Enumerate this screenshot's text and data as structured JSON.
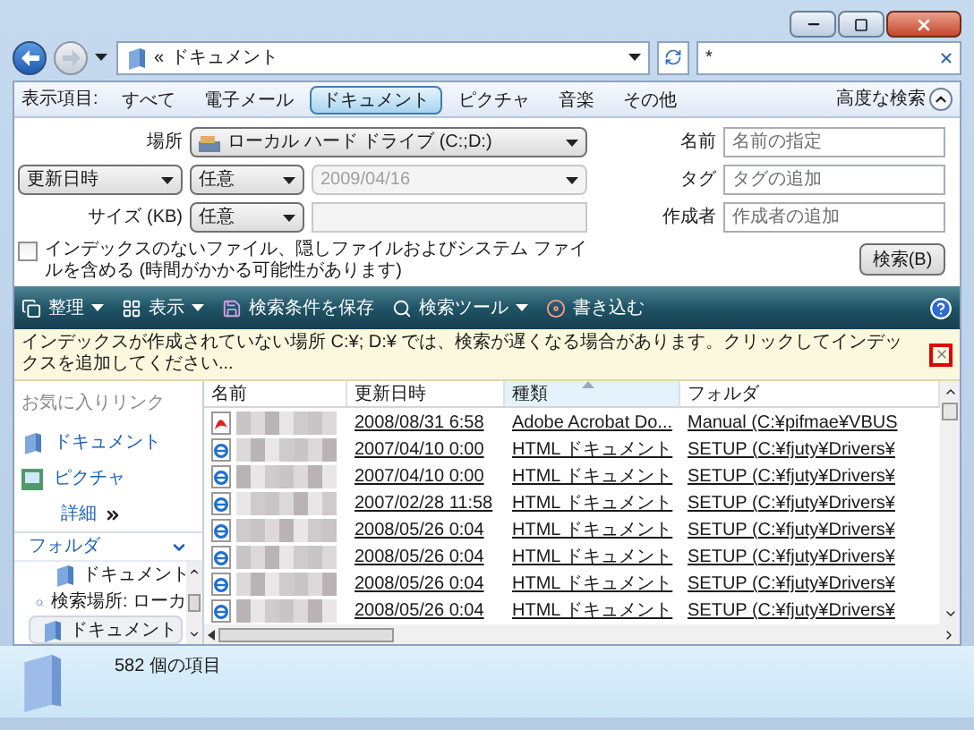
{
  "address": {
    "chevron": "«",
    "path": "ドキュメント"
  },
  "search": {
    "value": "*"
  },
  "filter_bar": {
    "label": "表示項目:",
    "items": [
      {
        "label": "すべて",
        "selected": false
      },
      {
        "label": "電子メール",
        "selected": false
      },
      {
        "label": "ドキュメント",
        "selected": true
      },
      {
        "label": "ピクチャ",
        "selected": false
      },
      {
        "label": "音楽",
        "selected": false
      },
      {
        "label": "その他",
        "selected": false
      }
    ],
    "advanced": "高度な検索",
    "expanded": true
  },
  "advanced_search": {
    "location_label": "場所",
    "location": "ローカル ハード ドライブ (C:;D:)",
    "date_field": "更新日時",
    "date_op": "任意",
    "date_value": "2009/04/16",
    "size_label": "サイズ (KB)",
    "size_op": "任意",
    "include_checkbox": {
      "label": "インデックスのないファイル、隠しファイルおよびシステム ファイルを含める (時間がかかる可能性があります)",
      "checked": false
    },
    "name_label": "名前",
    "name_placeholder": "名前の指定",
    "tag_label": "タグ",
    "tag_placeholder": "タグの追加",
    "author_label": "作成者",
    "author_placeholder": "作成者の追加",
    "search_button": "検索(B)"
  },
  "toolbar": [
    {
      "label": "整理",
      "kind": "menu"
    },
    {
      "label": "表示",
      "kind": "menu"
    },
    {
      "label": "検索条件を保存",
      "kind": "button"
    },
    {
      "label": "検索ツール",
      "kind": "menu"
    },
    {
      "label": "書き込む",
      "kind": "button"
    }
  ],
  "info_bar": {
    "text": "インデックスが作成されていない場所 C:¥; D:¥ では、検索が遅くなる場合があります。クリックしてインデックスを追加してください..."
  },
  "nav": {
    "favorites_title": "お気に入りリンク",
    "links": [
      "ドキュメント",
      "ピクチャ"
    ],
    "more": "詳細",
    "folders_title": "フォルダ",
    "tree": [
      {
        "label": "ドキュメント",
        "selected": false
      },
      {
        "label": "検索場所: ローカ",
        "selected": false,
        "children": [
          {
            "label": "ドキュメント",
            "selected": true
          }
        ]
      }
    ]
  },
  "table": {
    "columns": [
      {
        "label": "名前",
        "sorted": false
      },
      {
        "label": "更新日時",
        "sorted": false
      },
      {
        "label": "種類",
        "sorted": true
      },
      {
        "label": "フォルダ",
        "sorted": false
      }
    ],
    "rows": [
      {
        "kind": "pdf",
        "date": "2008/08/31 6:58",
        "type": "Adobe Acrobat Do...",
        "folder": "Manual (C:¥pifmae¥VBUS"
      },
      {
        "kind": "html",
        "date": "2007/04/10 0:00",
        "type": "HTML ドキュメント",
        "folder": "SETUP (C:¥fjuty¥Drivers¥"
      },
      {
        "kind": "html",
        "date": "2007/04/10 0:00",
        "type": "HTML ドキュメント",
        "folder": "SETUP (C:¥fjuty¥Drivers¥"
      },
      {
        "kind": "html",
        "date": "2007/02/28 11:58",
        "type": "HTML ドキュメント",
        "folder": "SETUP (C:¥fjuty¥Drivers¥"
      },
      {
        "kind": "html",
        "date": "2008/05/26 0:04",
        "type": "HTML ドキュメント",
        "folder": "SETUP (C:¥fjuty¥Drivers¥"
      },
      {
        "kind": "html",
        "date": "2008/05/26 0:04",
        "type": "HTML ドキュメント",
        "folder": "SETUP (C:¥fjuty¥Drivers¥"
      },
      {
        "kind": "html",
        "date": "2008/05/26 0:04",
        "type": "HTML ドキュメント",
        "folder": "SETUP (C:¥fjuty¥Drivers¥"
      },
      {
        "kind": "html",
        "date": "2008/05/26 0:04",
        "type": "HTML ドキュメント",
        "folder": "SETUP (C:¥fjuty¥Drivers¥"
      }
    ]
  },
  "status": {
    "count": "582 個の項目"
  }
}
